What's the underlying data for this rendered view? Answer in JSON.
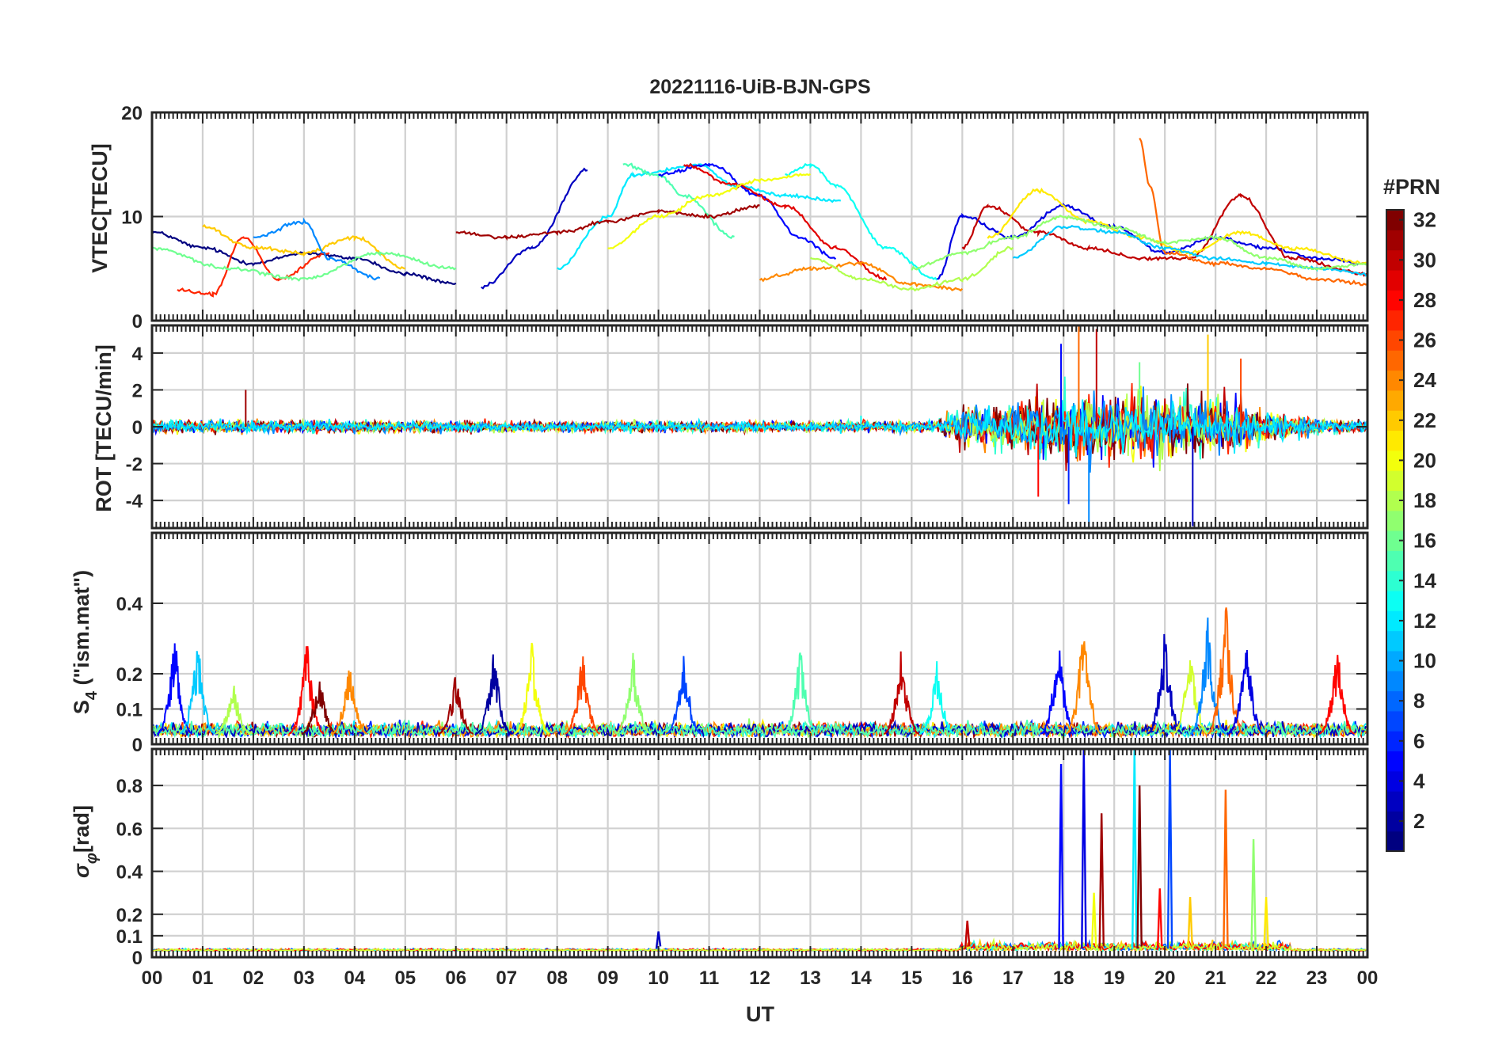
{
  "chart_data": {
    "type": "line",
    "title": "20221116-UiB-BJN-GPS",
    "xlabel": "UT",
    "x_tick_labels": [
      "00",
      "01",
      "02",
      "03",
      "04",
      "05",
      "06",
      "07",
      "08",
      "09",
      "10",
      "11",
      "12",
      "13",
      "14",
      "15",
      "16",
      "17",
      "18",
      "19",
      "20",
      "21",
      "22",
      "23",
      "00"
    ],
    "xlim": [
      0,
      24
    ],
    "grid": true,
    "colorbar": {
      "title": "#PRN",
      "range": [
        1,
        32
      ],
      "colormap": "jet",
      "tick_labels": [
        "2",
        "4",
        "6",
        "8",
        "10",
        "12",
        "14",
        "16",
        "18",
        "20",
        "22",
        "24",
        "26",
        "28",
        "30",
        "32"
      ]
    },
    "panels": [
      {
        "key": "vtec",
        "ylabel": "VTEC[TECU]",
        "ylim": [
          0,
          20
        ],
        "y_tick_labels": [
          {
            "v": 0,
            "t": "0"
          },
          {
            "v": 10,
            "t": "10"
          },
          {
            "v": 20,
            "t": "20"
          }
        ],
        "segments": [
          {
            "prn": 1,
            "x": [
              0.0,
              1.0,
              2.0,
              3.0,
              4.0,
              5.0,
              6.0
            ],
            "y": [
              8.5,
              7.0,
              5.5,
              6.5,
              6.0,
              4.5,
              3.5
            ]
          },
          {
            "prn": 3,
            "x": [
              6.5,
              7.5,
              8.6
            ],
            "y": [
              3.2,
              7.0,
              14.5
            ]
          },
          {
            "prn": 12,
            "x": [
              8.0,
              9.0,
              9.5,
              10.8,
              11.5,
              12.5,
              13.6
            ],
            "y": [
              5.0,
              10.0,
              14.0,
              15.0,
              13.0,
              12.0,
              11.5
            ]
          },
          {
            "prn": 15,
            "x": [
              9.3,
              10.0,
              10.5,
              11.5
            ],
            "y": [
              15.0,
              14.0,
              12.0,
              8.0
            ]
          },
          {
            "prn": 5,
            "x": [
              10.0,
              11.0,
              12.0,
              12.8,
              13.5
            ],
            "y": [
              14.0,
              15.0,
              12.0,
              8.0,
              6.0
            ]
          },
          {
            "prn": 29,
            "x": [
              10.5,
              11.5,
              12.5,
              13.5,
              14.5
            ],
            "y": [
              15.0,
              13.0,
              11.0,
              7.0,
              4.0
            ]
          },
          {
            "prn": 13,
            "x": [
              12.5,
              13.0,
              13.5,
              14.5,
              15.5
            ],
            "y": [
              14.0,
              15.0,
              13.0,
              7.0,
              4.0
            ]
          },
          {
            "prn": 31,
            "x": [
              6.0,
              7.0,
              8.0,
              9.0,
              10.0,
              11.0,
              12.0
            ],
            "y": [
              8.5,
              8.0,
              8.5,
              9.5,
              10.5,
              10.0,
              11.0
            ]
          },
          {
            "prn": 20,
            "x": [
              9.0,
              10.0,
              11.0,
              12.0,
              13.0
            ],
            "y": [
              7.0,
              10.0,
              12.0,
              13.5,
              14.0
            ]
          },
          {
            "prn": 27,
            "x": [
              0.5,
              1.2,
              1.8,
              2.5,
              3.5
            ],
            "y": [
              3.0,
              2.5,
              8.0,
              4.0,
              6.5
            ]
          },
          {
            "prn": 22,
            "x": [
              1.0,
              2.0,
              3.0,
              4.0,
              5.0
            ],
            "y": [
              9.0,
              7.0,
              6.5,
              8.0,
              5.0
            ]
          },
          {
            "prn": 9,
            "x": [
              2.0,
              3.0,
              3.5,
              4.5
            ],
            "y": [
              8.0,
              9.5,
              6.0,
              4.0
            ]
          },
          {
            "prn": 16,
            "x": [
              0.0,
              1.5,
              3.0,
              4.5,
              6.0
            ],
            "y": [
              7.0,
              5.0,
              4.0,
              6.5,
              5.0
            ]
          },
          {
            "prn": 24,
            "x": [
              12.0,
              13.0,
              14.0,
              15.0,
              16.0
            ],
            "y": [
              4.0,
              5.0,
              5.5,
              3.5,
              3.0
            ]
          },
          {
            "prn": 18,
            "x": [
              13.0,
              14.0,
              15.0,
              16.0,
              17.0
            ],
            "y": [
              6.0,
              4.0,
              3.0,
              4.0,
              7.0
            ]
          },
          {
            "prn": 4,
            "x": [
              15.5,
              16.0,
              17.0,
              18.0,
              19.0,
              20.0,
              21.0,
              22.0,
              23.0,
              24.0
            ],
            "y": [
              4.0,
              10.0,
              8.0,
              11.0,
              9.0,
              6.5,
              8.0,
              7.0,
              6.0,
              5.5
            ]
          },
          {
            "prn": 30,
            "x": [
              16.0,
              16.5,
              17.5,
              18.5,
              19.5,
              20.5,
              21.5,
              22.5,
              24.0
            ],
            "y": [
              7.0,
              11.0,
              8.5,
              7.0,
              6.0,
              6.0,
              12.0,
              6.0,
              4.5
            ]
          },
          {
            "prn": 21,
            "x": [
              16.5,
              17.5,
              18.5,
              19.5,
              20.5,
              21.5,
              22.5,
              24.0
            ],
            "y": [
              8.0,
              12.5,
              9.5,
              8.0,
              6.5,
              8.5,
              7.0,
              5.5
            ]
          },
          {
            "prn": 25,
            "x": [
              19.5,
              19.7,
              20.0,
              21.0,
              22.0,
              23.0,
              24.0
            ],
            "y": [
              17.5,
              13.0,
              6.5,
              5.5,
              5.0,
              4.0,
              3.5
            ]
          },
          {
            "prn": 11,
            "x": [
              17.0,
              18.0,
              19.0,
              20.0,
              21.0,
              22.0,
              23.0,
              24.0
            ],
            "y": [
              6.0,
              9.0,
              8.5,
              7.0,
              6.0,
              5.5,
              5.0,
              4.5
            ]
          },
          {
            "prn": 17,
            "x": [
              15.0,
              16.0,
              17.0,
              18.0,
              19.0,
              20.0,
              21.0,
              22.0,
              23.0,
              24.0
            ],
            "y": [
              5.0,
              6.5,
              8.0,
              10.0,
              9.0,
              7.5,
              8.0,
              6.0,
              5.0,
              5.5
            ]
          }
        ]
      },
      {
        "key": "rot",
        "ylabel": "ROT [TECU/min]",
        "ylim": [
          -5.5,
          5.5
        ],
        "y_tick_labels": [
          {
            "v": -4,
            "t": "-4"
          },
          {
            "v": -2,
            "t": "-2"
          },
          {
            "v": 0,
            "t": "0"
          },
          {
            "v": 2,
            "t": "2"
          },
          {
            "v": 4,
            "t": "4"
          }
        ],
        "envelope": [
          {
            "x": 0,
            "a": 0.6
          },
          {
            "x": 4,
            "a": 0.6
          },
          {
            "x": 8,
            "a": 0.5
          },
          {
            "x": 12,
            "a": 0.5
          },
          {
            "x": 15.5,
            "a": 0.5
          },
          {
            "x": 16,
            "a": 2.0
          },
          {
            "x": 17,
            "a": 2.2
          },
          {
            "x": 18,
            "a": 3.5
          },
          {
            "x": 19,
            "a": 3.0
          },
          {
            "x": 20,
            "a": 3.0
          },
          {
            "x": 21,
            "a": 2.8
          },
          {
            "x": 22,
            "a": 1.5
          },
          {
            "x": 23,
            "a": 0.8
          },
          {
            "x": 24,
            "a": 0.6
          }
        ],
        "spikes": [
          {
            "x": 17.95,
            "y": 4.5
          },
          {
            "x": 18.3,
            "y": 5.5
          },
          {
            "x": 18.65,
            "y": 5.3
          },
          {
            "x": 18.1,
            "y": -4.2
          },
          {
            "x": 18.5,
            "y": -5.5
          },
          {
            "x": 20.85,
            "y": 5.0
          },
          {
            "x": 20.55,
            "y": -5.4
          },
          {
            "x": 19.5,
            "y": 3.5
          },
          {
            "x": 17.5,
            "y": -3.8
          },
          {
            "x": 21.5,
            "y": 3.7
          },
          {
            "x": 1.85,
            "y": 2.0
          },
          {
            "x": 14.0,
            "y": 0.6
          }
        ]
      },
      {
        "key": "s4",
        "ylabel": "S_4 (\"ism.mat\")",
        "ylim": [
          0,
          0.6
        ],
        "y_tick_labels": [
          {
            "v": 0,
            "t": "0"
          },
          {
            "v": 0.1,
            "t": "0.1"
          },
          {
            "v": 0.2,
            "t": "0.2"
          },
          {
            "v": 0.4,
            "t": "0.4"
          }
        ],
        "bursts": [
          {
            "x": 0.45,
            "peak": 0.33,
            "prn": 5
          },
          {
            "x": 0.9,
            "peak": 0.32,
            "prn": 11
          },
          {
            "x": 1.6,
            "peak": 0.2,
            "prn": 18
          },
          {
            "x": 3.05,
            "peak": 0.32,
            "prn": 28
          },
          {
            "x": 3.3,
            "peak": 0.22,
            "prn": 32
          },
          {
            "x": 3.9,
            "peak": 0.27,
            "prn": 24
          },
          {
            "x": 6.0,
            "peak": 0.22,
            "prn": 31
          },
          {
            "x": 6.75,
            "peak": 0.28,
            "prn": 2
          },
          {
            "x": 7.5,
            "peak": 0.31,
            "prn": 20
          },
          {
            "x": 8.5,
            "peak": 0.27,
            "prn": 26
          },
          {
            "x": 9.5,
            "peak": 0.27,
            "prn": 17
          },
          {
            "x": 10.5,
            "peak": 0.28,
            "prn": 7
          },
          {
            "x": 12.8,
            "peak": 0.3,
            "prn": 15
          },
          {
            "x": 14.8,
            "peak": 0.29,
            "prn": 30
          },
          {
            "x": 15.5,
            "peak": 0.24,
            "prn": 13
          },
          {
            "x": 17.9,
            "peak": 0.34,
            "prn": 5
          },
          {
            "x": 18.4,
            "peak": 0.4,
            "prn": 24
          },
          {
            "x": 20.0,
            "peak": 0.34,
            "prn": 3
          },
          {
            "x": 20.5,
            "peak": 0.3,
            "prn": 19
          },
          {
            "x": 20.85,
            "peak": 0.39,
            "prn": 9
          },
          {
            "x": 21.2,
            "peak": 0.45,
            "prn": 25
          },
          {
            "x": 21.6,
            "peak": 0.35,
            "prn": 4
          },
          {
            "x": 23.4,
            "peak": 0.3,
            "prn": 28
          }
        ]
      },
      {
        "key": "sigma",
        "ylabel": "σ_φ[rad]",
        "ylim": [
          0,
          0.97
        ],
        "y_tick_labels": [
          {
            "v": 0,
            "t": "0"
          },
          {
            "v": 0.1,
            "t": "0.1"
          },
          {
            "v": 0.2,
            "t": "0.2"
          },
          {
            "v": 0.4,
            "t": "0.4"
          },
          {
            "v": 0.6,
            "t": "0.6"
          },
          {
            "v": 0.8,
            "t": "0.8"
          }
        ],
        "spikes": [
          {
            "x": 17.95,
            "y": 0.9,
            "prn": 5
          },
          {
            "x": 18.4,
            "y": 0.97,
            "prn": 4
          },
          {
            "x": 18.75,
            "y": 0.67,
            "prn": 31
          },
          {
            "x": 19.4,
            "y": 0.97,
            "prn": 12
          },
          {
            "x": 19.5,
            "y": 0.8,
            "prn": 32
          },
          {
            "x": 20.1,
            "y": 0.97,
            "prn": 7
          },
          {
            "x": 21.2,
            "y": 0.78,
            "prn": 25
          },
          {
            "x": 21.75,
            "y": 0.55,
            "prn": 17
          },
          {
            "x": 18.6,
            "y": 0.3,
            "prn": 20
          },
          {
            "x": 19.9,
            "y": 0.32,
            "prn": 28
          },
          {
            "x": 20.5,
            "y": 0.28,
            "prn": 22
          },
          {
            "x": 22.0,
            "y": 0.28,
            "prn": 21
          },
          {
            "x": 16.1,
            "y": 0.17,
            "prn": 30
          },
          {
            "x": 10.0,
            "y": 0.12,
            "prn": 3
          }
        ]
      }
    ]
  }
}
